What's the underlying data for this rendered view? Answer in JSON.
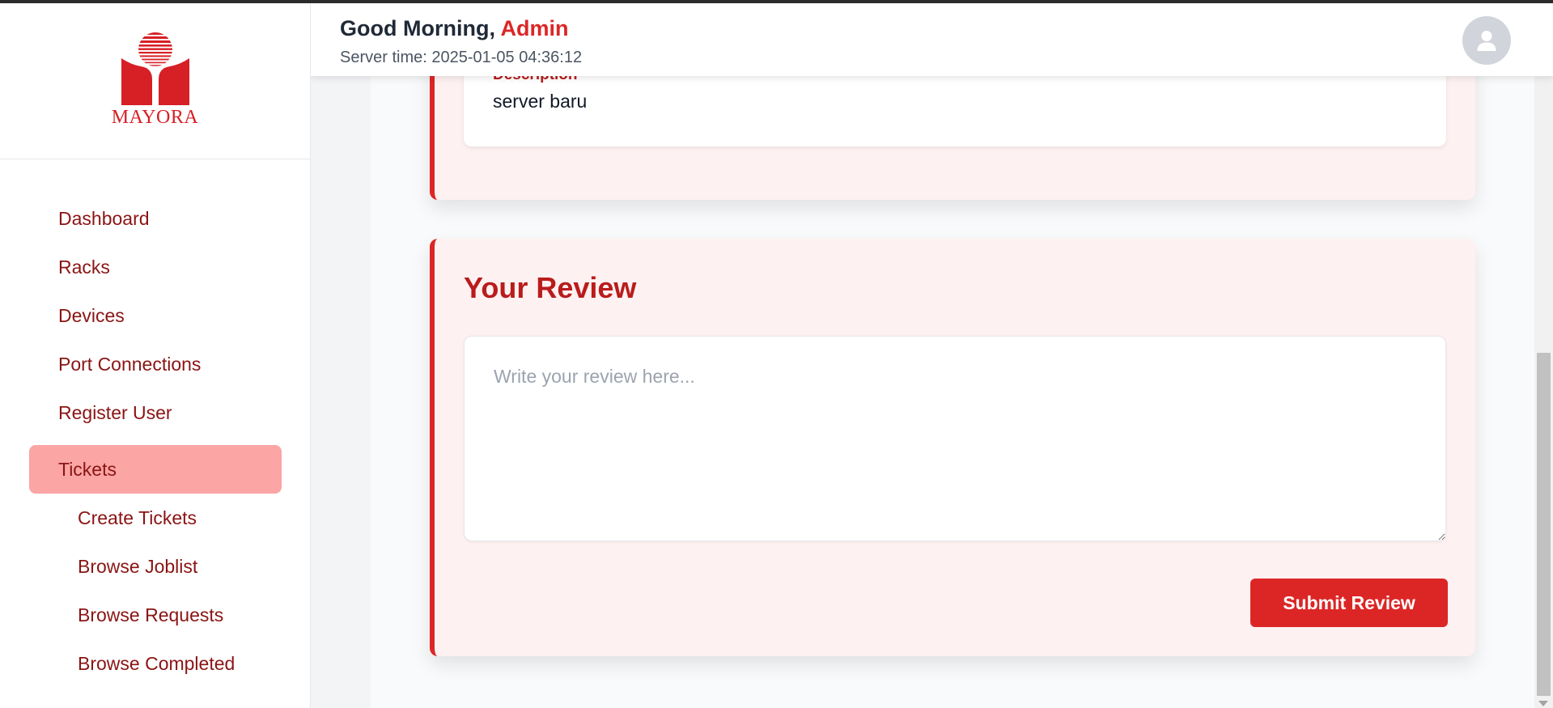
{
  "brand": {
    "logo_text": "MAYORA",
    "brand_color": "#dc2626"
  },
  "header": {
    "greeting_prefix": "Good Morning, ",
    "user_name": "Admin",
    "server_time": "Server time: 2025-01-05 04:36:12",
    "avatar_icon": "user-icon"
  },
  "sidebar": {
    "items": [
      {
        "label": "Dashboard",
        "active": false,
        "sub": false
      },
      {
        "label": "Racks",
        "active": false,
        "sub": false
      },
      {
        "label": "Devices",
        "active": false,
        "sub": false
      },
      {
        "label": "Port Connections",
        "active": false,
        "sub": false
      },
      {
        "label": "Register User",
        "active": false,
        "sub": false
      },
      {
        "label": "Tickets",
        "active": true,
        "sub": false
      },
      {
        "label": "Create Tickets",
        "active": false,
        "sub": true
      },
      {
        "label": "Browse Joblist",
        "active": false,
        "sub": true
      },
      {
        "label": "Browse Requests",
        "active": false,
        "sub": true
      },
      {
        "label": "Browse Completed",
        "active": false,
        "sub": true
      }
    ]
  },
  "ticket": {
    "description_label": "Description",
    "description_value": "server baru"
  },
  "review": {
    "title": "Your Review",
    "placeholder": "Write your review here...",
    "value": "",
    "submit_label": "Submit Review"
  }
}
